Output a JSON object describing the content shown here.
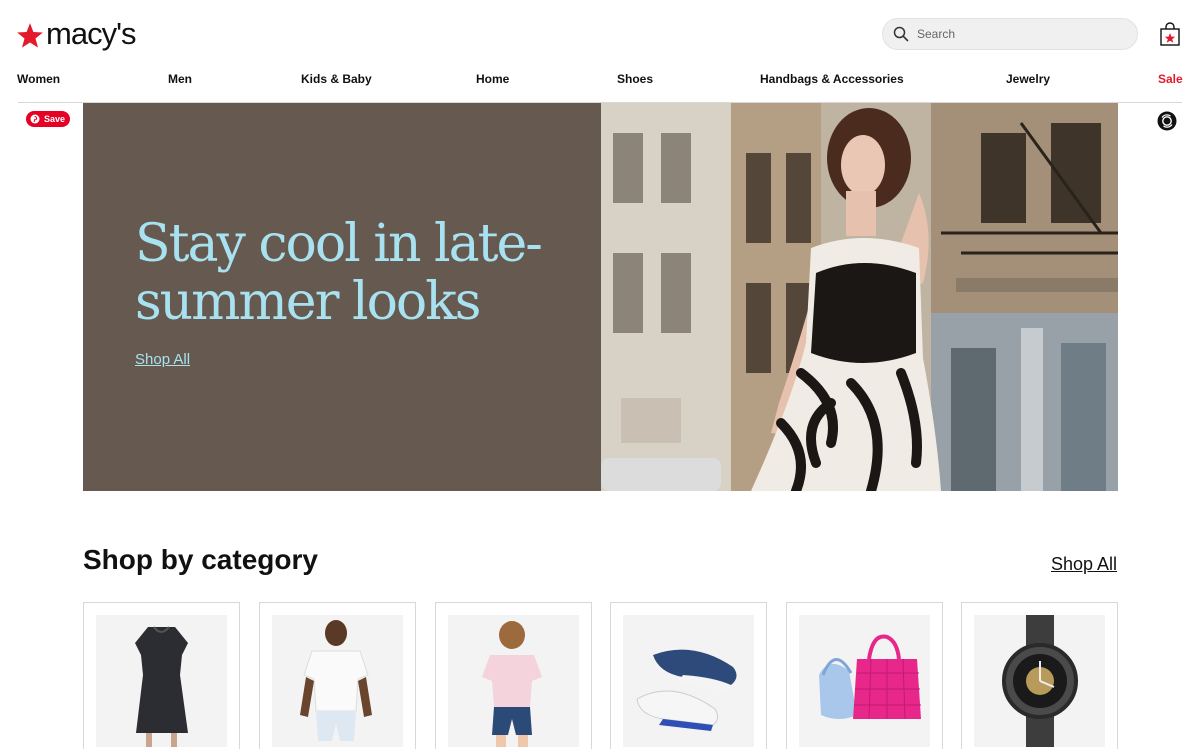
{
  "header": {
    "logo_text": "macy's",
    "search_placeholder": "Search"
  },
  "nav": {
    "items": [
      {
        "label": "Women"
      },
      {
        "label": "Men"
      },
      {
        "label": "Kids & Baby"
      },
      {
        "label": "Home"
      },
      {
        "label": "Shoes"
      },
      {
        "label": "Handbags & Accessories"
      },
      {
        "label": "Jewelry"
      },
      {
        "label": "Sale"
      }
    ]
  },
  "pin": {
    "save_label": "Save"
  },
  "hero": {
    "headline": "Stay cool in late-summer looks",
    "link": "Shop All"
  },
  "category_section": {
    "title": "Shop by category",
    "link": "Shop All",
    "cards": [
      {
        "icon": "dress-image"
      },
      {
        "icon": "men-tshirt-image"
      },
      {
        "icon": "kids-outfit-image"
      },
      {
        "icon": "sneakers-image"
      },
      {
        "icon": "handbags-image"
      },
      {
        "icon": "watch-image"
      }
    ]
  },
  "colors": {
    "brand_red": "#e21a2c",
    "hero_bg": "#655950",
    "hero_text": "#a8e2f0",
    "pin_red": "#e60023"
  }
}
